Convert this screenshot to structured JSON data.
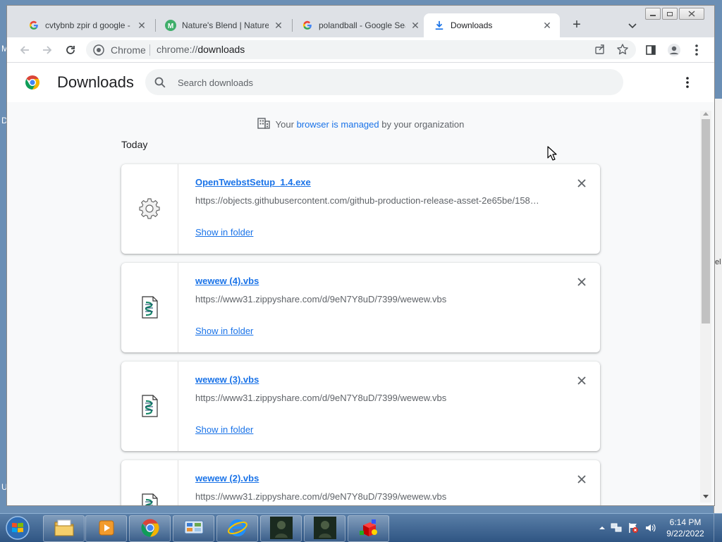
{
  "desktop": {
    "edge_letters": [
      "M",
      "D",
      "U"
    ],
    "right_edge_text": "el"
  },
  "tabs": [
    {
      "title": "cvtybnb zpir d google -",
      "favicon": "google-icon",
      "active": false
    },
    {
      "title": "Nature's Blend | Natures",
      "favicon": "m-letter-icon",
      "active": false
    },
    {
      "title": "polandball - Google Sea",
      "favicon": "google-icon",
      "active": false
    },
    {
      "title": "Downloads",
      "favicon": "download-icon",
      "active": true
    }
  ],
  "toolbar": {
    "omnibox_label": "Chrome",
    "url_prefix": "chrome://",
    "url_host": "downloads"
  },
  "page": {
    "title": "Downloads",
    "search_placeholder": "Search downloads",
    "managed": {
      "prefix": "Your ",
      "link": "browser is managed",
      "suffix": " by your organization"
    },
    "section_label": "Today",
    "show_in_folder_label": "Show in folder",
    "downloads": [
      {
        "name": "OpenTwebstSetup_1.4.exe",
        "url": "https://objects.githubusercontent.com/github-production-release-asset-2e65be/158…",
        "icon": "gear-icon"
      },
      {
        "name": "wewew (4).vbs",
        "url": "https://www31.zippyshare.com/d/9eN7Y8uD/7399/wewew.vbs",
        "icon": "script-file-icon"
      },
      {
        "name": "wewew (3).vbs",
        "url": "https://www31.zippyshare.com/d/9eN7Y8uD/7399/wewew.vbs",
        "icon": "script-file-icon"
      },
      {
        "name": "wewew (2).vbs",
        "url": "https://www31.zippyshare.com/d/9eN7Y8uD/7399/wewew.vbs",
        "icon": "script-file-icon"
      }
    ]
  },
  "taskbar": {
    "items": [
      "file-explorer-icon",
      "media-player-icon",
      "chrome-icon",
      "control-panel-icon",
      "internet-explorer-icon",
      "game-character-icon",
      "game-character-icon",
      "3d-cube-icon"
    ],
    "clock": {
      "time": "6:14 PM",
      "date": "9/22/2022"
    }
  },
  "colors": {
    "accent": "#1a73e8",
    "tab_bar": "#dee1e6",
    "page_bg": "#f8f9fa"
  }
}
